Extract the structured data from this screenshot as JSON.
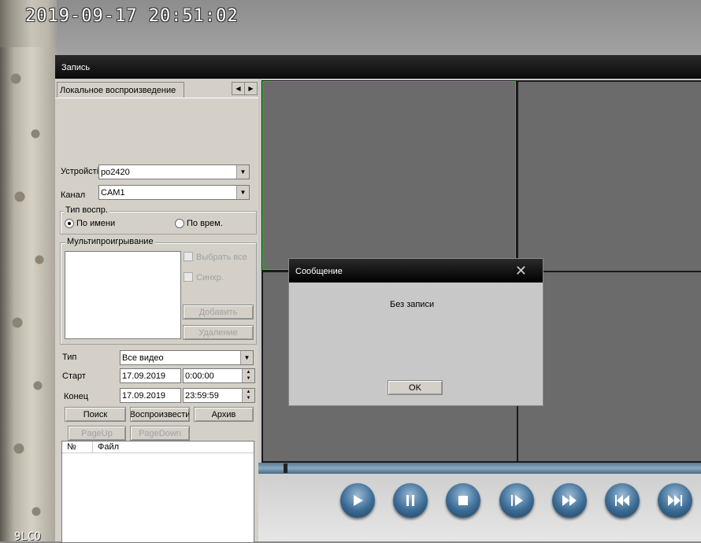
{
  "overlay": {
    "timestamp": "2019-09-17 20:51:02",
    "corner_text": "9LCO"
  },
  "window": {
    "title": "Запись"
  },
  "tab": {
    "label": "Локальное воспроизведение"
  },
  "form": {
    "device_label": "Устройсті",
    "device_value": "po2420",
    "channel_label": "Канал",
    "channel_value": "CAM1",
    "playback_type_title": "Тип воспр.",
    "by_name_label": "По имени",
    "by_time_label": "По врем.",
    "by_name_selected": true,
    "multiplay_title": "Мультипроигрывание",
    "select_all_label": "Выбрать все",
    "sync_label": "Синхр.",
    "add_button": "Добавить",
    "delete_button": "Удаление",
    "type_label": "Тип",
    "type_value": "Все видео",
    "start_label": "Старт",
    "start_date": "17.09.2019",
    "start_time": "0:00:00",
    "end_label": "Конец",
    "end_date": "17.09.2019",
    "end_time": "23:59:59",
    "search_button": "Поиск",
    "play_button": "Воспроизвести",
    "archive_button": "Архив",
    "pageup_button": "PageUp",
    "pagedown_button": "PageDown",
    "col_number": "№",
    "col_file": "Файл"
  },
  "controls": {
    "buttons": [
      "play-icon",
      "pause-icon",
      "stop-icon",
      "step-forward-icon",
      "fast-forward-icon",
      "skip-back-icon",
      "skip-forward-icon"
    ]
  },
  "dialog": {
    "title": "Сообщение",
    "message": "Без записи",
    "ok_button": "OK"
  },
  "colors": {
    "titlebar": "#0a0a0a",
    "selected_cell_border": "#4caf3f",
    "panel": "#d4d0c8",
    "video_cell": "#6b6b6b"
  }
}
